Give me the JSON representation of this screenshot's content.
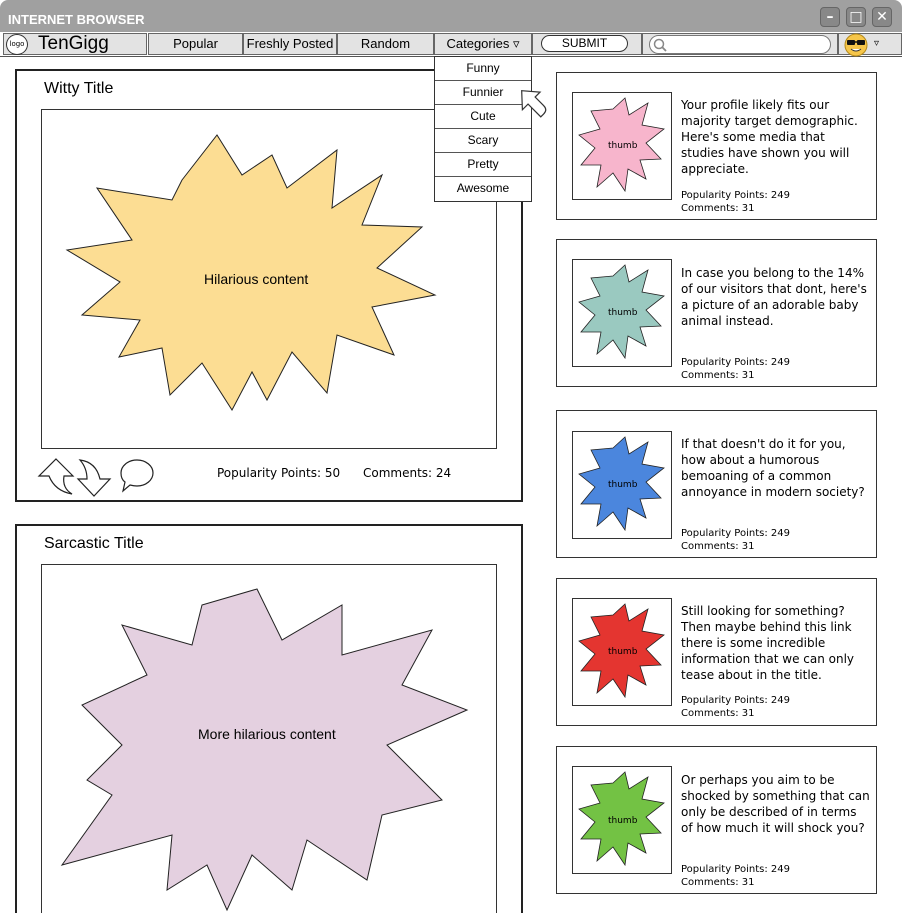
{
  "window": {
    "title": "INTERNET BROWSER",
    "minimize": "–",
    "maximize": "□",
    "close": "✕"
  },
  "header": {
    "logo_text": "logo",
    "site_name": "TenGigg",
    "nav": [
      "Popular",
      "Freshly Posted",
      "Random",
      "Categories ▿"
    ],
    "submit_label": "SUBMIT",
    "search_placeholder": "",
    "avatar_caret": "▿"
  },
  "categories_menu": [
    "Funny",
    "Funnier",
    "Cute",
    "Scary",
    "Pretty",
    "Awesome"
  ],
  "posts": [
    {
      "title": "Witty Title",
      "content_label": "Hilarious content",
      "popularity": "Popularity Points: 50",
      "comments": "Comments: 24",
      "color": "#fcdd93"
    },
    {
      "title": "Sarcastic Title",
      "content_label": "More hilarious content",
      "color": "#e4d0e0"
    }
  ],
  "sidebar": [
    {
      "thumb_label": "thumb",
      "color": "#f7b5cc",
      "text": "Your profile likely fits our majority target demographic. Here's some media that studies have shown you will appreciate.",
      "popularity": "Popularity Points: 249",
      "comments": "Comments: 31"
    },
    {
      "thumb_label": "thumb",
      "color": "#9ac9c0",
      "text": "In case you belong to the 14% of our visitors that dont, here's a picture of an adorable baby animal instead.",
      "popularity": "Popularity Points: 249",
      "comments": "Comments: 31"
    },
    {
      "thumb_label": "thumb",
      "color": "#4b86dd",
      "text": "If that doesn't do it for you, how about a humorous bemoaning of a common annoyance in modern society?",
      "popularity": "Popularity Points: 249",
      "comments": "Comments: 31"
    },
    {
      "thumb_label": "thumb",
      "color": "#e43530",
      "text": "Still looking for something? Then maybe behind this link there is some incredible information that we can only tease about in the title.",
      "popularity": "Popularity Points: 249",
      "comments": "Comments: 31"
    },
    {
      "thumb_label": "thumb",
      "color": "#73c244",
      "text": "Or perhaps you aim to be shocked by something that can only be described of in terms of how much it will shock you?",
      "popularity": "Popularity Points: 249",
      "comments": "Comments: 31"
    }
  ]
}
